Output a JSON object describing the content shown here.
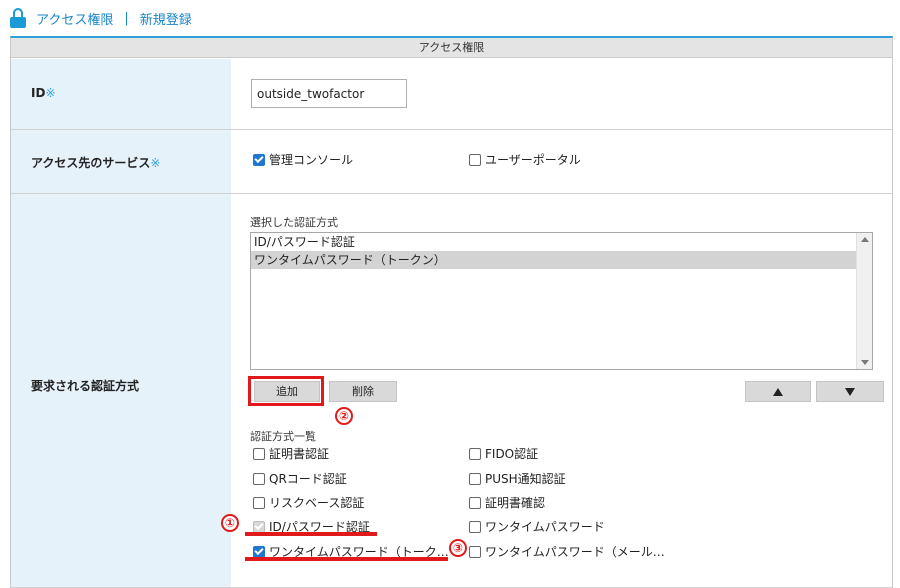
{
  "breadcrumb": {
    "section": "アクセス権限",
    "separator": "|",
    "page": "新規登録"
  },
  "panel": {
    "title": "アクセス権限"
  },
  "fields": {
    "id": {
      "label": "ID",
      "required_mark": "※",
      "value": "outside_twofactor"
    },
    "service": {
      "label": "アクセス先のサービス",
      "required_mark": "※",
      "options": [
        {
          "label": "管理コンソール",
          "checked": true
        },
        {
          "label": "ユーザーポータル",
          "checked": false
        }
      ]
    },
    "auth": {
      "label": "要求される認証方式",
      "selected_label": "選択した認証方式",
      "selected_items": [
        "ID/パスワード認証",
        "ワンタイムパスワード（トークン）"
      ],
      "selected_highlight_index": 1,
      "buttons": {
        "add": "追加",
        "delete": "削除"
      },
      "list_label": "認証方式一覧",
      "methods_left": [
        {
          "label": "証明書認証",
          "state": "unchecked"
        },
        {
          "label": "QRコード認証",
          "state": "unchecked"
        },
        {
          "label": "リスクベース認証",
          "state": "unchecked"
        },
        {
          "label": "ID/パスワード認証",
          "state": "disabled-checked"
        },
        {
          "label": "ワンタイムパスワード（トーク…",
          "state": "checked"
        }
      ],
      "methods_right": [
        {
          "label": "FIDO認証",
          "state": "unchecked"
        },
        {
          "label": "PUSH通知認証",
          "state": "unchecked"
        },
        {
          "label": "証明書確認",
          "state": "unchecked"
        },
        {
          "label": "ワンタイムパスワード",
          "state": "unchecked"
        },
        {
          "label": "ワンタイムパスワード（メール…",
          "state": "unchecked"
        }
      ]
    }
  },
  "annotations": {
    "one": "①",
    "two": "②",
    "three": "③"
  },
  "colors": {
    "accent": "#1a9ad6",
    "label_bg": "#e6f2fa",
    "highlight": "#e1191a",
    "checkbox_on": "#1f77d0"
  }
}
